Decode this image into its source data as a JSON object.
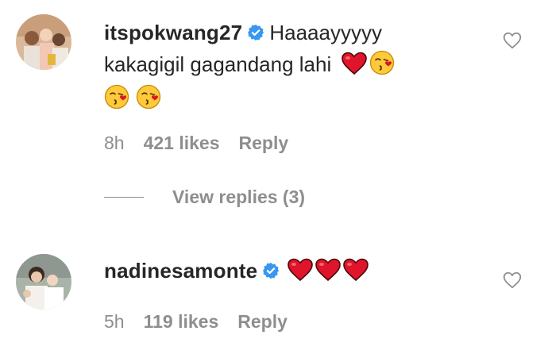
{
  "comments": [
    {
      "username": "itspokwang27",
      "text_line1": "Haaaayyyyy",
      "text_line2": "kakagigil gagandang lahi",
      "time": "8h",
      "likes": "421 likes",
      "reply": "Reply"
    },
    {
      "username": "nadinesamonte",
      "time": "5h",
      "likes": "119 likes",
      "reply": "Reply"
    }
  ],
  "view_replies": "View replies (3)",
  "colors": {
    "text": "#262626",
    "secondary": "#8e8e8e",
    "verified": "#3897f0",
    "heart": "#e0142a"
  },
  "icons": [
    "verified-badge-icon",
    "heart-emoji",
    "kissing-face-emoji",
    "like-heart-outline-icon"
  ]
}
